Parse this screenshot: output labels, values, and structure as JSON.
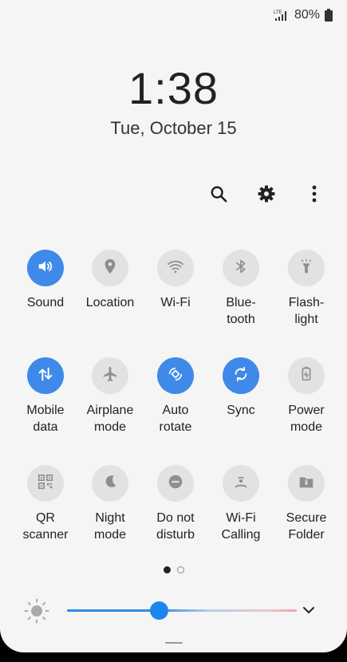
{
  "status": {
    "network": "LTE",
    "battery": "80%"
  },
  "clock": {
    "time": "1:38",
    "date": "Tue, October 15"
  },
  "quick_tiles": [
    [
      {
        "id": "sound",
        "label": "Sound",
        "icon": "sound-icon",
        "on": true
      },
      {
        "id": "location",
        "label": "Location",
        "icon": "location-pin-icon",
        "on": false
      },
      {
        "id": "wifi",
        "label": "Wi-Fi",
        "icon": "wifi-icon",
        "on": false
      },
      {
        "id": "bluetooth",
        "label": "Blue-\ntooth",
        "icon": "bluetooth-icon",
        "on": false
      },
      {
        "id": "flashlight",
        "label": "Flash-\nlight",
        "icon": "flashlight-icon",
        "on": false
      }
    ],
    [
      {
        "id": "mobile-data",
        "label": "Mobile\ndata",
        "icon": "mobile-data-icon",
        "on": true
      },
      {
        "id": "airplane",
        "label": "Airplane\nmode",
        "icon": "airplane-icon",
        "on": false
      },
      {
        "id": "auto-rotate",
        "label": "Auto\nrotate",
        "icon": "auto-rotate-icon",
        "on": true
      },
      {
        "id": "sync",
        "label": "Sync",
        "icon": "sync-icon",
        "on": true
      },
      {
        "id": "power-mode",
        "label": "Power\nmode",
        "icon": "power-mode-icon",
        "on": false
      }
    ],
    [
      {
        "id": "qr-scanner",
        "label": "QR\nscanner",
        "icon": "qr-code-icon",
        "on": false
      },
      {
        "id": "night-mode",
        "label": "Night\nmode",
        "icon": "moon-icon",
        "on": false
      },
      {
        "id": "do-not-disturb",
        "label": "Do not\ndisturb",
        "icon": "do-not-disturb-icon",
        "on": false
      },
      {
        "id": "wifi-calling",
        "label": "Wi-Fi\nCalling",
        "icon": "wifi-calling-icon",
        "on": false
      },
      {
        "id": "secure-folder",
        "label": "Secure\nFolder",
        "icon": "secure-folder-icon",
        "on": false
      }
    ]
  ],
  "pager": {
    "count": 2,
    "active": 0
  },
  "brightness": {
    "level": 0.4
  },
  "colors": {
    "accent": "#3f89e8",
    "tile_off": "#e2e2e2",
    "background": "#f5f5f5"
  }
}
